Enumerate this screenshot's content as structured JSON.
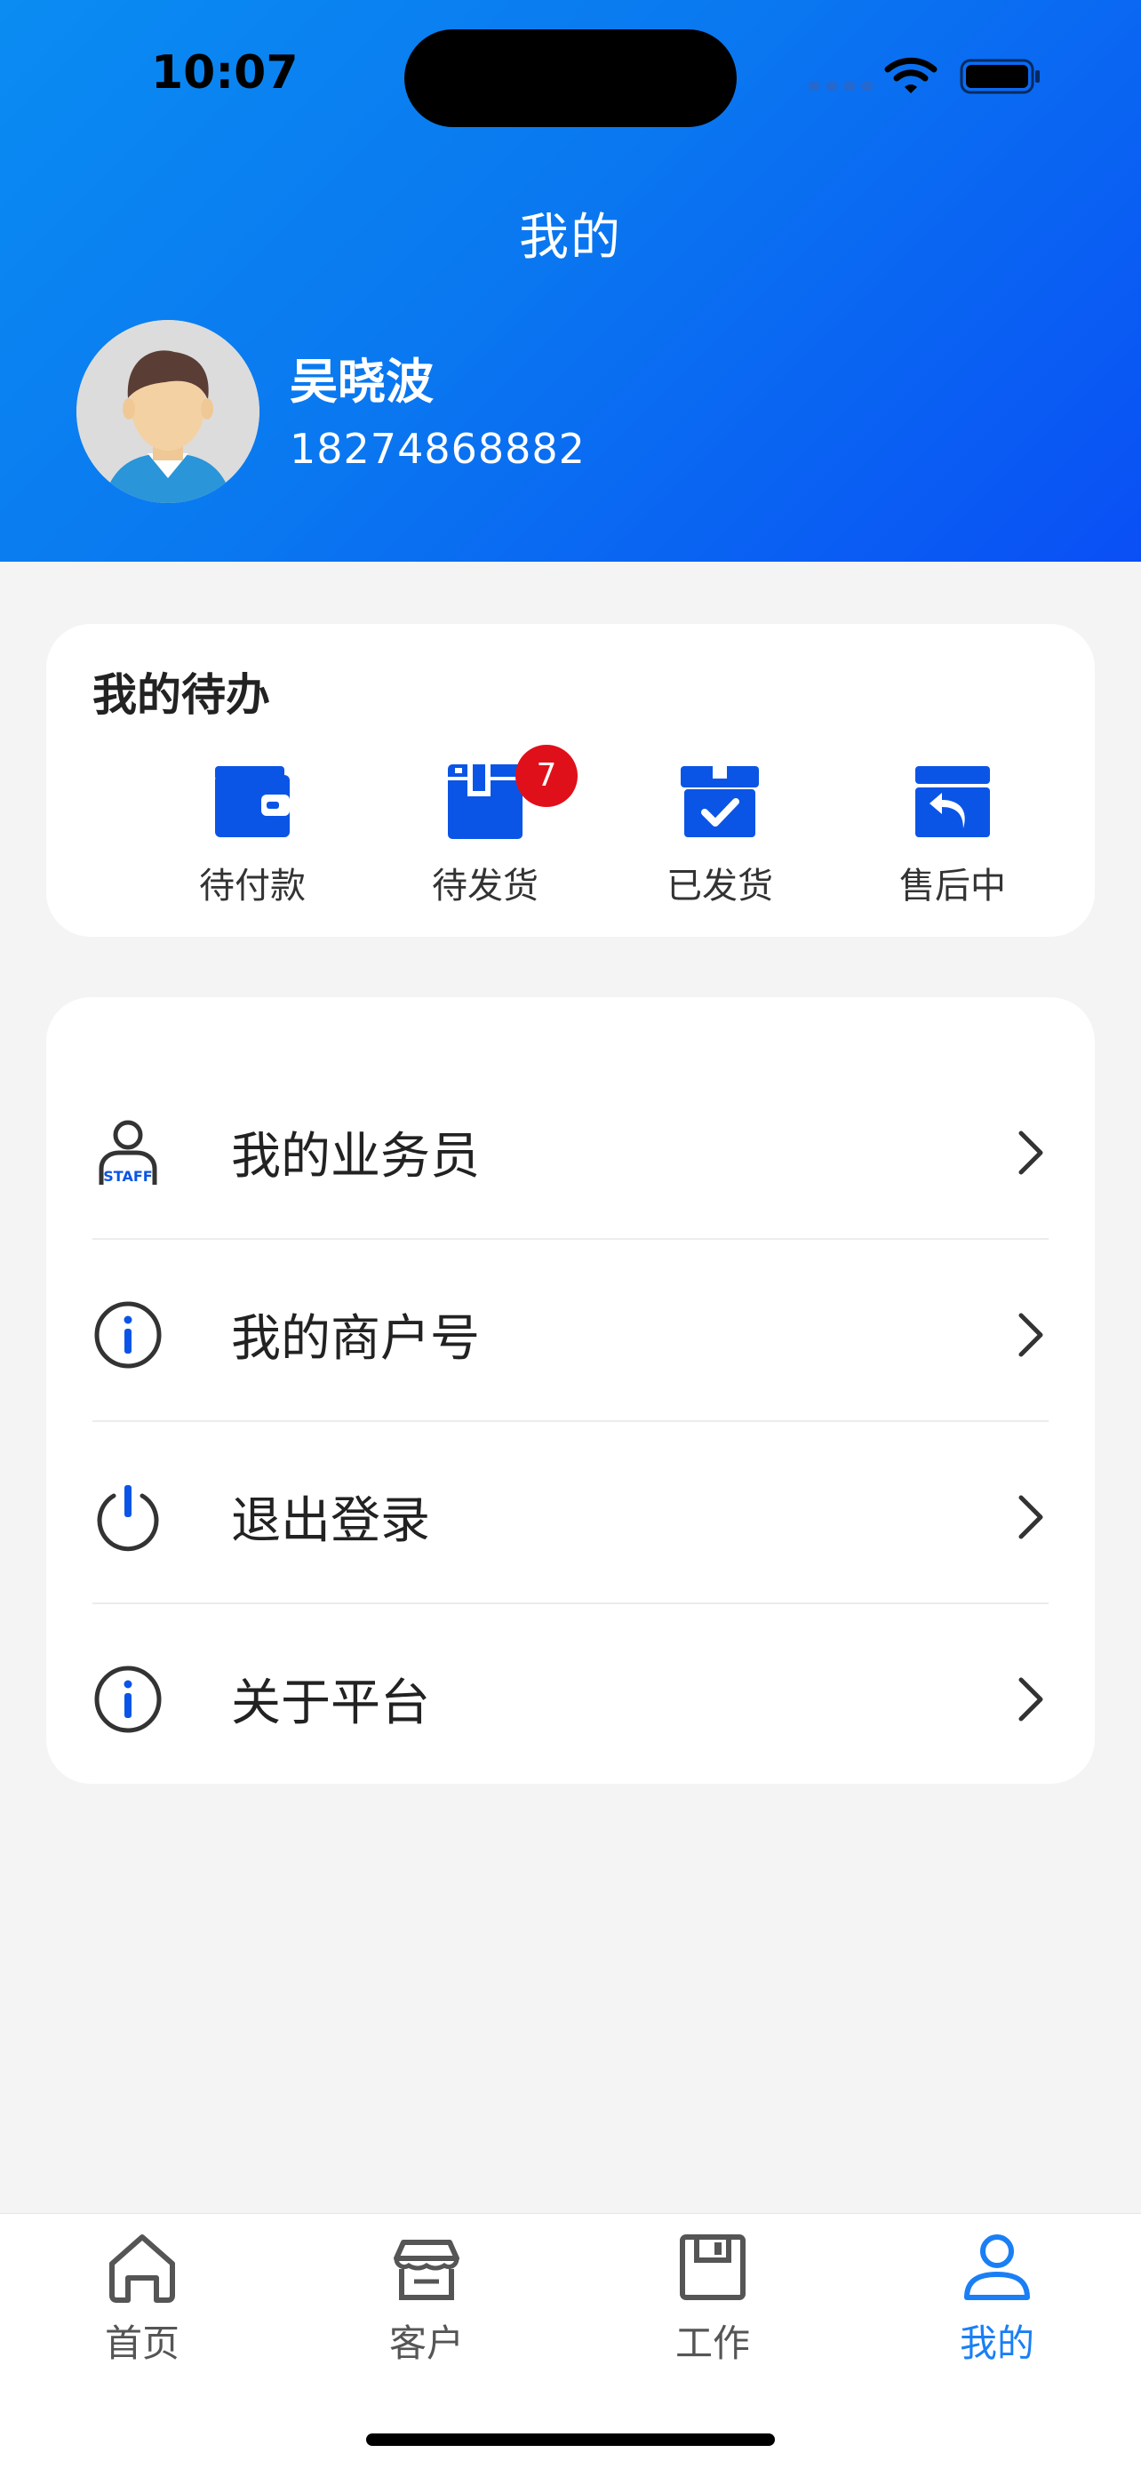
{
  "status_bar": {
    "time": "10:07"
  },
  "header": {
    "title": "我的",
    "user": {
      "name": "吴晓波",
      "phone": "18274868882"
    }
  },
  "todo": {
    "title": "我的待办",
    "items": [
      {
        "label": "待付款",
        "icon": "wallet-icon"
      },
      {
        "label": "待发货",
        "icon": "package-icon",
        "badge": "7"
      },
      {
        "label": "已发货",
        "icon": "box-check-icon"
      },
      {
        "label": "售后中",
        "icon": "return-icon"
      }
    ]
  },
  "menu": {
    "items": [
      {
        "label": "我的业务员",
        "icon": "staff-icon"
      },
      {
        "label": "我的商户号",
        "icon": "info-icon"
      },
      {
        "label": "退出登录",
        "icon": "power-icon"
      },
      {
        "label": "关于平台",
        "icon": "info-icon"
      }
    ]
  },
  "tabbar": {
    "items": [
      {
        "label": "首页",
        "icon": "home-icon"
      },
      {
        "label": "客户",
        "icon": "store-icon"
      },
      {
        "label": "工作",
        "icon": "save-icon"
      },
      {
        "label": "我的",
        "icon": "user-icon",
        "active": true
      }
    ]
  },
  "colors": {
    "accent": "#1a7ff5",
    "icon_blue": "#0b55e6",
    "badge_red": "#e0101a"
  }
}
